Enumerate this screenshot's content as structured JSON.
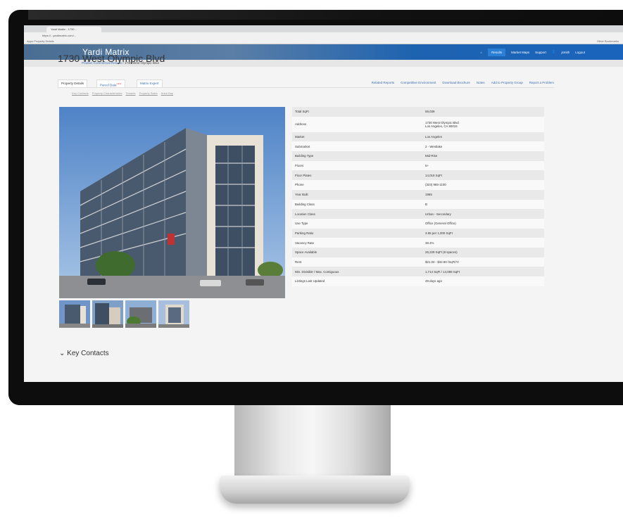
{
  "browser": {
    "tab_title": "Yardi Matrix - 1730...",
    "address": "https://...yardimatrix.com/...",
    "bookmarks_left": "Apps  Property Details",
    "bookmarks_right": "Other Bookmarks"
  },
  "app": {
    "logo": "Yardi Matrix",
    "nav": {
      "results": "Results",
      "market_maps": "Market Maps",
      "support": "Support",
      "user": "jsmith",
      "logout": "Logout"
    }
  },
  "breadcrumb": {
    "home": "Product Commercial Results",
    "current": "1730 West Olympic Blvd"
  },
  "page_title": "1730 West Olympic Blvd",
  "tabs": {
    "property_details": "Property Details",
    "parcel": "Parcel Data",
    "parcel_badge": "NEW",
    "matrix_expert": "Matrix Expert"
  },
  "actions": {
    "related_reports": "Related Reports",
    "competitive_environment": "Competitive Environment",
    "download_brochure": "Download Brochure",
    "notes": "Notes",
    "add_to_group": "Add to Property Group",
    "report_problem": "Report a Problem"
  },
  "sublinks": [
    "Key Contacts",
    "Property Characteristics",
    "Tenants",
    "Property Sales",
    "Area Map"
  ],
  "details": [
    {
      "label": "Total SqFt",
      "value": "59,039"
    },
    {
      "label": "Address",
      "value": "1730 West Olympic Blvd",
      "value2": "Los Angeles, CA 90015"
    },
    {
      "label": "Market",
      "value": "Los Angeles"
    },
    {
      "label": "Submarket",
      "value": "2 - Westlake"
    },
    {
      "label": "Building Type",
      "value": "Mid-Rise"
    },
    {
      "label": "Floors",
      "value": "6+"
    },
    {
      "label": "Floor Plates",
      "value": "14,018 SqFt"
    },
    {
      "label": "Phone",
      "value": "(323) 965-1100"
    },
    {
      "label": "Year Built",
      "value": "1965"
    },
    {
      "label": "Building Class",
      "value": "B"
    },
    {
      "label": "Location Class",
      "value": "Urban - Secondary"
    },
    {
      "label": "Use Type",
      "value": "Office (General Office)"
    },
    {
      "label": "Parking Ratio",
      "value": "3.85 per 1,000 SqFt"
    },
    {
      "label": "Vacancy Rate",
      "value": "38.4%"
    },
    {
      "label": "Space Available",
      "value": "26,229 SqFt (8 spaces)"
    },
    {
      "label": "Rent",
      "value": "$21.00 - $32.80 /SqFt/Yr"
    },
    {
      "label": "Min. Divisible / Max. Contiguous",
      "value": "1,714 SqFt / 14,089 SqFt"
    },
    {
      "label": "Listings Last Updated",
      "value": "49 days ago"
    }
  ],
  "section": {
    "key_contacts": "Key Contacts"
  },
  "colors": {
    "nav_blue": "#1a64bd",
    "link_blue": "#3a6fb5",
    "sky": "#5d8bc9"
  }
}
